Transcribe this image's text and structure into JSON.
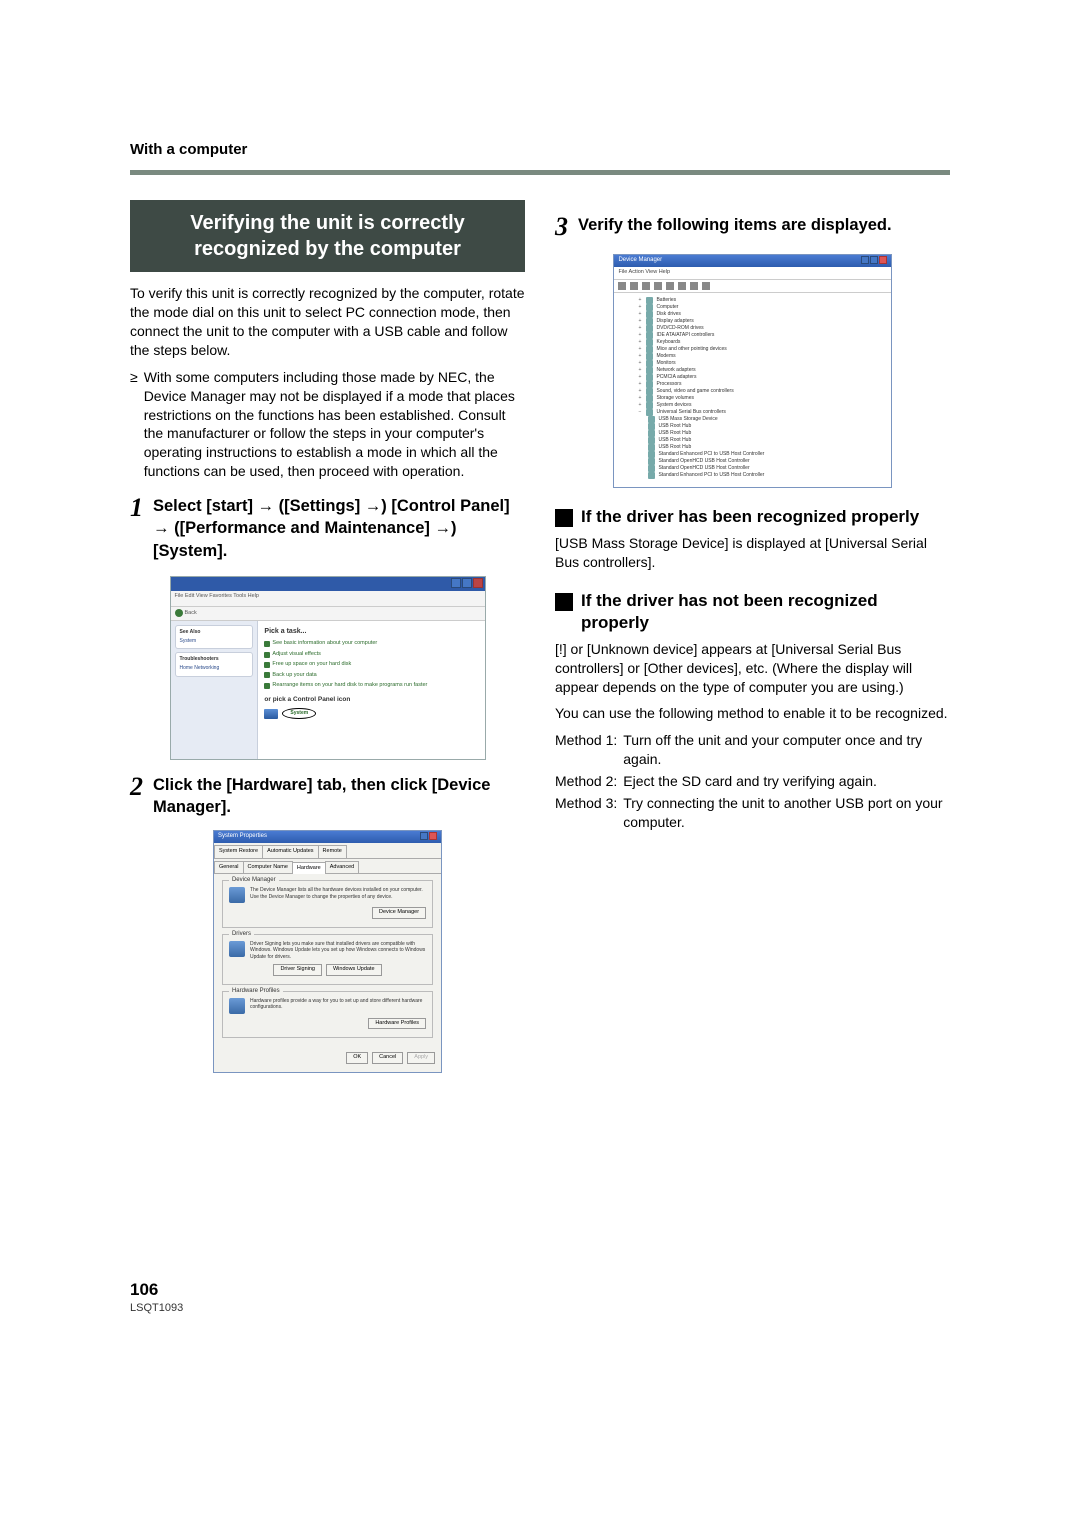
{
  "header": {
    "section": "With a computer"
  },
  "left": {
    "bannerTitle": "Verifying the unit is correctly recognized by the computer",
    "intro": "To verify this unit is correctly recognized by the computer, rotate the mode dial on this unit to select PC connection mode, then connect the unit to the computer with a USB cable and follow the steps below.",
    "bullet": "With some computers including those made by NEC, the Device Manager may not be displayed if a mode that places restrictions on the functions has been established. Consult the manufacturer or follow the steps in your computer's operating instructions to establish a mode in which all the functions can be used, then proceed with operation.",
    "step1": {
      "num": "1",
      "text": "Select [start] → ([Settings] →) [Control Panel] → ([Performance and Maintenance] →) [System]."
    },
    "cp": {
      "menu": "File   Edit   View   Favorites   Tools   Help",
      "back": "Back",
      "sidetitle1": "See Also",
      "sideitems1": [
        "System"
      ],
      "sidetitle2": "Troubleshooters",
      "sideitems2": [
        "Home Networking"
      ],
      "pick": "Pick a task...",
      "tasks": [
        "See basic information about your computer",
        "Adjust visual effects",
        "Free up space on your hard disk",
        "Back up your data",
        "Rearrange items on your hard disk to make programs run faster"
      ],
      "orpick": "or pick a Control Panel icon",
      "systemLabel": "System"
    },
    "step2": {
      "num": "2",
      "text": "Click the [Hardware] tab, then click [Device Manager]."
    },
    "sysprop": {
      "title": "System Properties",
      "tabs": [
        "System Restore",
        "Automatic Updates",
        "Remote",
        "General",
        "Computer Name",
        "Hardware",
        "Advanced"
      ],
      "group1": {
        "legend": "Device Manager",
        "text": "The Device Manager lists all the hardware devices installed on your computer. Use the Device Manager to change the properties of any device.",
        "btn": "Device Manager"
      },
      "group2": {
        "legend": "Drivers",
        "text": "Driver Signing lets you make sure that installed drivers are compatible with Windows. Windows Update lets you set up how Windows connects to Windows Update for drivers.",
        "btn1": "Driver Signing",
        "btn2": "Windows Update"
      },
      "group3": {
        "legend": "Hardware Profiles",
        "text": "Hardware profiles provide a way for you to set up and store different hardware configurations.",
        "btn": "Hardware Profiles"
      },
      "ok": "OK",
      "cancel": "Cancel",
      "apply": "Apply"
    }
  },
  "right": {
    "step3": {
      "num": "3",
      "text": "Verify the following items are displayed."
    },
    "devmgr": {
      "title": "Device Manager",
      "menu": "File    Action    View    Help",
      "nodes": [
        "Batteries",
        "Computer",
        "Disk drives",
        "Display adapters",
        "DVD/CD-ROM drives",
        "IDE ATA/ATAPI controllers",
        "Keyboards",
        "Mice and other pointing devices",
        "Modems",
        "Monitors",
        "Network adapters",
        "PCMCIA adapters",
        "Processors",
        "Sound, video and game controllers",
        "Storage volumes",
        "System devices",
        "Universal Serial Bus controllers"
      ],
      "usb": [
        "USB Mass Storage Device",
        "USB Root Hub",
        "USB Root Hub",
        "USB Root Hub",
        "USB Root Hub",
        "Standard Enhanced PCI to USB Host Controller",
        "Standard OpenHCD USB Host Controller",
        "Standard OpenHCD USB Host Controller",
        "Standard Enhanced PCI to USB Host Controller"
      ]
    },
    "sh1": "If the driver has been recognized properly",
    "sh1_text": "[USB Mass Storage Device] is displayed at [Universal Serial Bus controllers].",
    "sh2": "If the driver has not been recognized properly",
    "sh2_p1": "[!] or [Unknown device] appears at [Universal Serial Bus controllers] or [Other devices], etc. (Where the display will appear depends on the type of computer you are using.)",
    "sh2_p2": "You can use the following method to enable it to be recognized.",
    "methods": [
      {
        "label": "Method 1:",
        "text": "Turn off the unit and your computer once and try again."
      },
      {
        "label": "Method 2:",
        "text": "Eject the SD card and try verifying again."
      },
      {
        "label": "Method 3:",
        "text": "Try connecting the unit to another USB port on your computer."
      }
    ]
  },
  "footer": {
    "page": "106",
    "code": "LSQT1093"
  }
}
